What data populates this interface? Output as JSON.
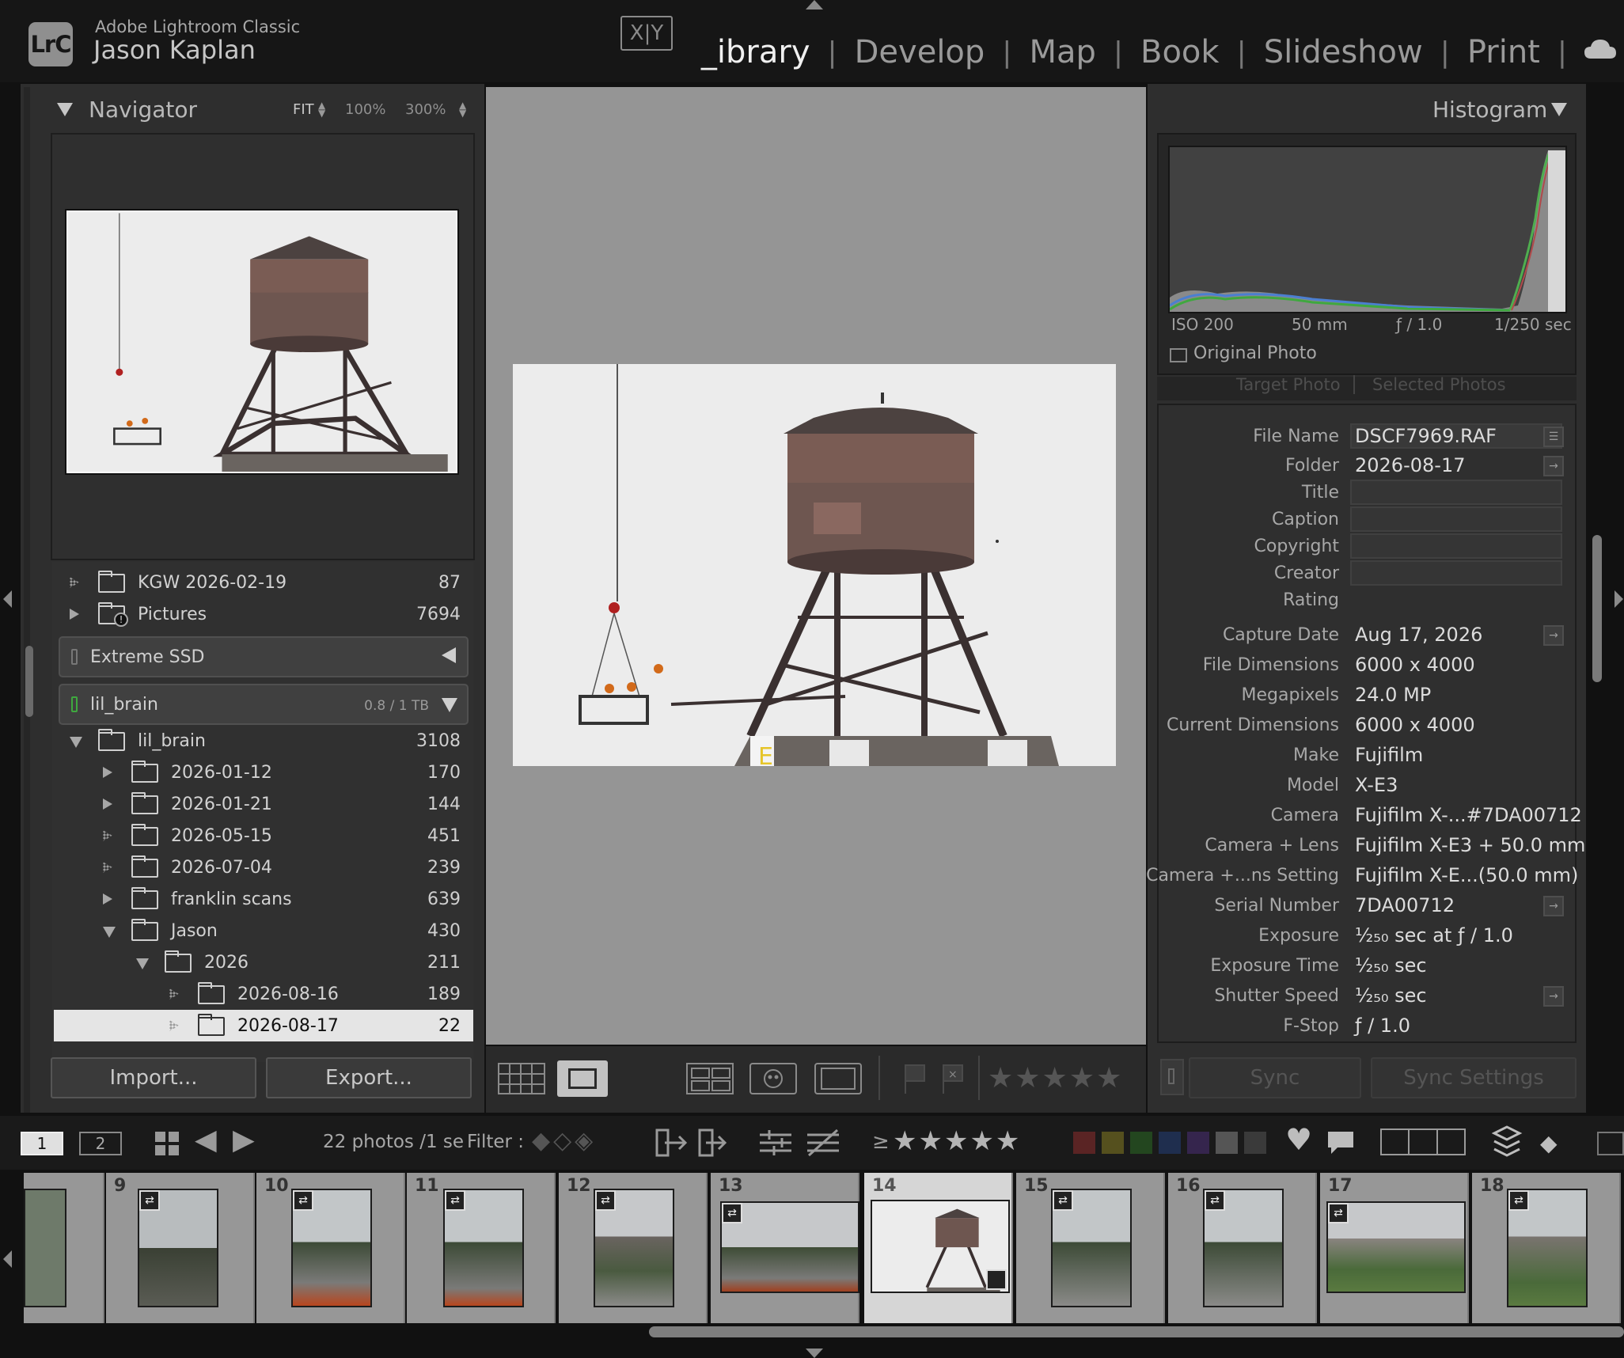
{
  "header": {
    "logo": "LrC",
    "app_name": "Adobe Lightroom Classic",
    "user_name": "Jason Kaplan",
    "modules": [
      {
        "label": "_ibrary",
        "active": true
      },
      {
        "label": "Develop"
      },
      {
        "label": "Map"
      },
      {
        "label": "Book"
      },
      {
        "label": "Slideshow"
      },
      {
        "label": "Print"
      }
    ]
  },
  "navigator": {
    "title": "Navigator",
    "zoom_fit": "FIT",
    "zoom_100": "100%",
    "zoom_300": "300%"
  },
  "folders": {
    "top_rows": [
      {
        "name": "KGW 2026-02-19",
        "count": "87"
      },
      {
        "name": "Pictures",
        "count": "7694"
      }
    ],
    "volume_external": {
      "name": "Extreme SSD"
    },
    "volume_internal": {
      "name": "lil_brain",
      "usage": "0.8 / 1 TB"
    },
    "tree": [
      {
        "name": "lil_brain",
        "count": "3108"
      },
      {
        "name": "2026-01-12",
        "count": "170"
      },
      {
        "name": "2026-01-21",
        "count": "144"
      },
      {
        "name": "2026-05-15",
        "count": "451"
      },
      {
        "name": "2026-07-04",
        "count": "239"
      },
      {
        "name": "franklin scans",
        "count": "639"
      },
      {
        "name": "Jason",
        "count": "430"
      },
      {
        "name": "2026",
        "count": "211"
      },
      {
        "name": "2026-08-16",
        "count": "189"
      },
      {
        "name": "2026-08-17",
        "count": "22"
      }
    ]
  },
  "buttons": {
    "import": "Import...",
    "export": "Export...",
    "sync": "Sync",
    "sync_settings": "Sync Settings"
  },
  "histogram": {
    "title": "Histogram",
    "iso": "ISO 200",
    "focal": "50 mm",
    "aperture": "ƒ / 1.0",
    "shutter": "1/250 sec",
    "original_photo": "Original Photo"
  },
  "metadata_tabs": {
    "target": "Target Photo",
    "selected": "Selected Photos"
  },
  "metadata": {
    "file_name": {
      "label": "File Name",
      "value": "DSCF7969.RAF"
    },
    "folder": {
      "label": "Folder",
      "value": "2026-08-17"
    },
    "title": {
      "label": "Title"
    },
    "caption": {
      "label": "Caption"
    },
    "copyright": {
      "label": "Copyright"
    },
    "creator": {
      "label": "Creator"
    },
    "rating": {
      "label": "Rating"
    },
    "capture_date": {
      "label": "Capture Date",
      "value": "Aug 17, 2026"
    },
    "file_dimensions": {
      "label": "File Dimensions",
      "value": "6000 x 4000"
    },
    "megapixels": {
      "label": "Megapixels",
      "value": "24.0 MP"
    },
    "current_dimensions": {
      "label": "Current Dimensions",
      "value": "6000 x 4000"
    },
    "make": {
      "label": "Make",
      "value": "Fujifilm"
    },
    "model": {
      "label": "Model",
      "value": "X-E3"
    },
    "camera": {
      "label": "Camera",
      "value": "Fujifilm X-...#7DA00712"
    },
    "camera_lens": {
      "label": "Camera + Lens",
      "value": "Fujifilm X-E3 + 50.0 mm"
    },
    "camera_lens_setting": {
      "label": "Camera +...ns Setting",
      "value": "Fujifilm X-E...(50.0 mm)"
    },
    "serial": {
      "label": "Serial Number",
      "value": "7DA00712"
    },
    "exposure": {
      "label": "Exposure",
      "value": "¹⁄₂₅₀ sec at ƒ / 1.0"
    },
    "exposure_time": {
      "label": "Exposure Time",
      "value": "¹⁄₂₅₀ sec"
    },
    "shutter_speed": {
      "label": "Shutter Speed",
      "value": "¹⁄₂₅₀ sec"
    },
    "fstop": {
      "label": "F-Stop",
      "value": "ƒ / 1.0"
    }
  },
  "filmbar": {
    "screen1": "1",
    "screen2": "2",
    "count": "22 photos /1 se",
    "filter_label": "Filter :",
    "rating_gte": "≥"
  },
  "filmstrip": [
    {
      "num": ""
    },
    {
      "num": "9"
    },
    {
      "num": "10"
    },
    {
      "num": "11"
    },
    {
      "num": "12"
    },
    {
      "num": "13"
    },
    {
      "num": "14",
      "selected": true
    },
    {
      "num": "15"
    },
    {
      "num": "16"
    },
    {
      "num": "17"
    },
    {
      "num": "18"
    }
  ],
  "colors": {
    "accent_selected": "#e5e5e5",
    "background": "#111111",
    "panel": "#2e2e2e",
    "canvas": "#959595"
  }
}
